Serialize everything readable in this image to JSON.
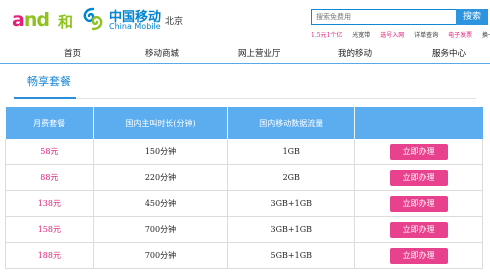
{
  "header": {
    "and_logo_text": "and",
    "and_logo_he": "和",
    "brand_cn": "中国移动",
    "brand_en": "China Mobile",
    "city": "北京",
    "search": {
      "placeholder": "搜索免费用",
      "button": "搜索"
    },
    "quick_links": [
      "1.5元1个亿",
      "光宽带",
      "选号入网",
      "详单查询",
      "电子发票",
      "换卡"
    ]
  },
  "nav": [
    "首页",
    "移动商城",
    "网上营业厅",
    "我的移动",
    "服务中心"
  ],
  "section": {
    "title": "畅享套餐"
  },
  "table": {
    "headers": [
      "月费套餐",
      "国内主叫时长(分钟)",
      "国内移动数据流量",
      ""
    ],
    "rows": [
      {
        "price": "58元",
        "minutes": "150分钟",
        "data": "1GB",
        "action": "立即办理"
      },
      {
        "price": "88元",
        "minutes": "220分钟",
        "data": "2GB",
        "action": "立即办理"
      },
      {
        "price": "138元",
        "minutes": "450分钟",
        "data": "3GB+1GB",
        "action": "立即办理"
      },
      {
        "price": "158元",
        "minutes": "700分钟",
        "data": "3GB+1GB",
        "action": "立即办理"
      },
      {
        "price": "188元",
        "minutes": "700分钟",
        "data": "5GB+1GB",
        "action": "立即办理"
      }
    ]
  },
  "colors": {
    "accent": "#2d95e0",
    "header_blue": "#5badf0",
    "pink": "#e0227a",
    "button_pink": "#e8418d",
    "and_green": "#8dc21f"
  }
}
